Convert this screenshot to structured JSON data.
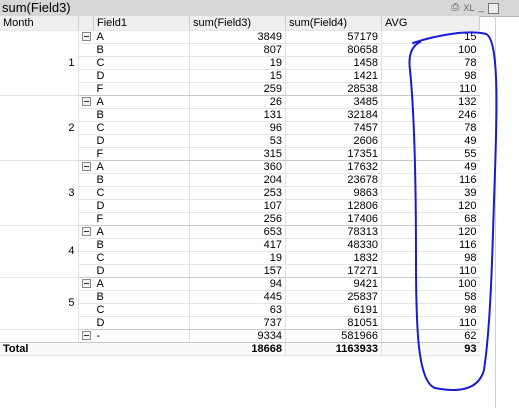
{
  "window": {
    "title": "sum(Field3)",
    "icons": [
      "print-icon",
      "xl-export-icon",
      "minimize-icon",
      "restore-icon"
    ],
    "xl_label": "XL"
  },
  "headers": {
    "month": "Month",
    "field1": "Field1",
    "field3": "sum(Field3)",
    "field4": "sum(Field4)",
    "avg": "AVG"
  },
  "groups": [
    {
      "month": "1",
      "rows": [
        {
          "field1": "A",
          "sum3": "3849",
          "sum4": "57179",
          "avg": "15"
        },
        {
          "field1": "B",
          "sum3": "807",
          "sum4": "80658",
          "avg": "100"
        },
        {
          "field1": "C",
          "sum3": "19",
          "sum4": "1458",
          "avg": "78"
        },
        {
          "field1": "D",
          "sum3": "15",
          "sum4": "1421",
          "avg": "98"
        },
        {
          "field1": "F",
          "sum3": "259",
          "sum4": "28538",
          "avg": "110"
        }
      ]
    },
    {
      "month": "2",
      "rows": [
        {
          "field1": "A",
          "sum3": "26",
          "sum4": "3485",
          "avg": "132"
        },
        {
          "field1": "B",
          "sum3": "131",
          "sum4": "32184",
          "avg": "246"
        },
        {
          "field1": "C",
          "sum3": "96",
          "sum4": "7457",
          "avg": "78"
        },
        {
          "field1": "D",
          "sum3": "53",
          "sum4": "2606",
          "avg": "49"
        },
        {
          "field1": "F",
          "sum3": "315",
          "sum4": "17351",
          "avg": "55"
        }
      ]
    },
    {
      "month": "3",
      "rows": [
        {
          "field1": "A",
          "sum3": "360",
          "sum4": "17632",
          "avg": "49"
        },
        {
          "field1": "B",
          "sum3": "204",
          "sum4": "23678",
          "avg": "116"
        },
        {
          "field1": "C",
          "sum3": "253",
          "sum4": "9863",
          "avg": "39"
        },
        {
          "field1": "D",
          "sum3": "107",
          "sum4": "12806",
          "avg": "120"
        },
        {
          "field1": "F",
          "sum3": "256",
          "sum4": "17406",
          "avg": "68"
        }
      ]
    },
    {
      "month": "4",
      "rows": [
        {
          "field1": "A",
          "sum3": "653",
          "sum4": "78313",
          "avg": "120"
        },
        {
          "field1": "B",
          "sum3": "417",
          "sum4": "48330",
          "avg": "116"
        },
        {
          "field1": "C",
          "sum3": "19",
          "sum4": "1832",
          "avg": "98"
        },
        {
          "field1": "D",
          "sum3": "157",
          "sum4": "17271",
          "avg": "110"
        }
      ]
    },
    {
      "month": "5",
      "rows": [
        {
          "field1": "A",
          "sum3": "94",
          "sum4": "9421",
          "avg": "100"
        },
        {
          "field1": "B",
          "sum3": "445",
          "sum4": "25837",
          "avg": "58"
        },
        {
          "field1": "C",
          "sum3": "63",
          "sum4": "6191",
          "avg": "98"
        },
        {
          "field1": "D",
          "sum3": "737",
          "sum4": "81051",
          "avg": "110"
        }
      ]
    },
    {
      "month": "",
      "rows": [
        {
          "field1": "-",
          "sum3": "9334",
          "sum4": "581966",
          "avg": "62"
        }
      ]
    }
  ],
  "total": {
    "label": "Total",
    "sum3": "18668",
    "sum4": "1163933",
    "avg": "93"
  },
  "colors": {
    "annotation": "#1a1ad6",
    "titlebar": "#d7d7d7"
  }
}
